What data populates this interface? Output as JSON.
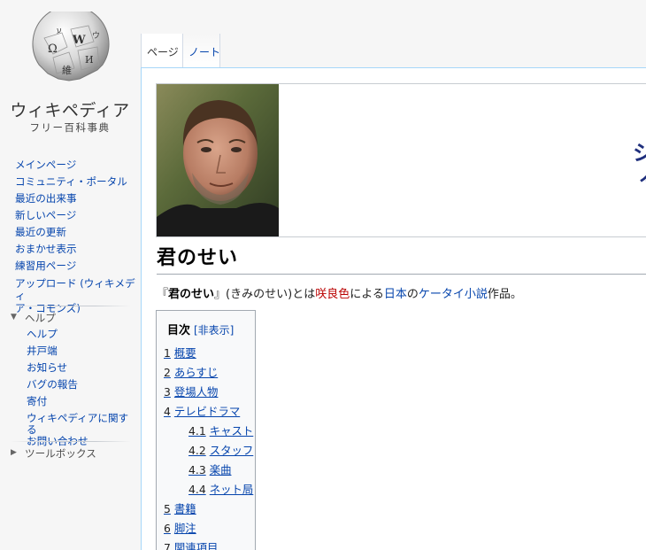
{
  "logo": {
    "wordmark": "ウィキペディア",
    "tagline": "フリー百科事典"
  },
  "nav": {
    "items": [
      "メインページ",
      "コミュニティ・ポータル",
      "最近の出来事",
      "新しいページ",
      "最近の更新",
      "おまかせ表示",
      "練習用ページ"
    ],
    "upload_line1": "アップロード (ウィキメディ",
    "upload_line2": "ア・コモンズ)"
  },
  "help": {
    "title": "ヘルプ",
    "items": [
      "ヘルプ",
      "井戸端",
      "お知らせ",
      "バグの報告",
      "寄付"
    ],
    "contact_line1": "ウィキペディアに関する",
    "contact_line2": "お問い合わせ"
  },
  "toolbox": {
    "title": "ツールボックス"
  },
  "tabs": {
    "page": "ページ",
    "note": "ノート"
  },
  "banner": {
    "text": "シ\n ぶ"
  },
  "article": {
    "title": "君のせい",
    "lead": {
      "open_quote": "『",
      "bold_title": "君のせい",
      "close_quote": "』",
      "reading": "(きみのせい)とは",
      "author_link": "咲良色",
      "by": "による",
      "japan_link": "日本",
      "no": "の",
      "genre_link": "ケータイ小説",
      "end": "作品。"
    }
  },
  "toc": {
    "title": "目次",
    "toggle": "[非表示]",
    "items": [
      {
        "num": "1",
        "label": "概要"
      },
      {
        "num": "2",
        "label": "あらすじ"
      },
      {
        "num": "3",
        "label": "登場人物"
      },
      {
        "num": "4",
        "label": "テレビドラマ"
      },
      {
        "num": "4.1",
        "label": "キャスト"
      },
      {
        "num": "4.2",
        "label": "スタッフ"
      },
      {
        "num": "4.3",
        "label": "楽曲"
      },
      {
        "num": "4.4",
        "label": "ネット局"
      },
      {
        "num": "5",
        "label": "書籍"
      },
      {
        "num": "6",
        "label": "脚注"
      },
      {
        "num": "7",
        "label": "関連項目"
      }
    ]
  }
}
